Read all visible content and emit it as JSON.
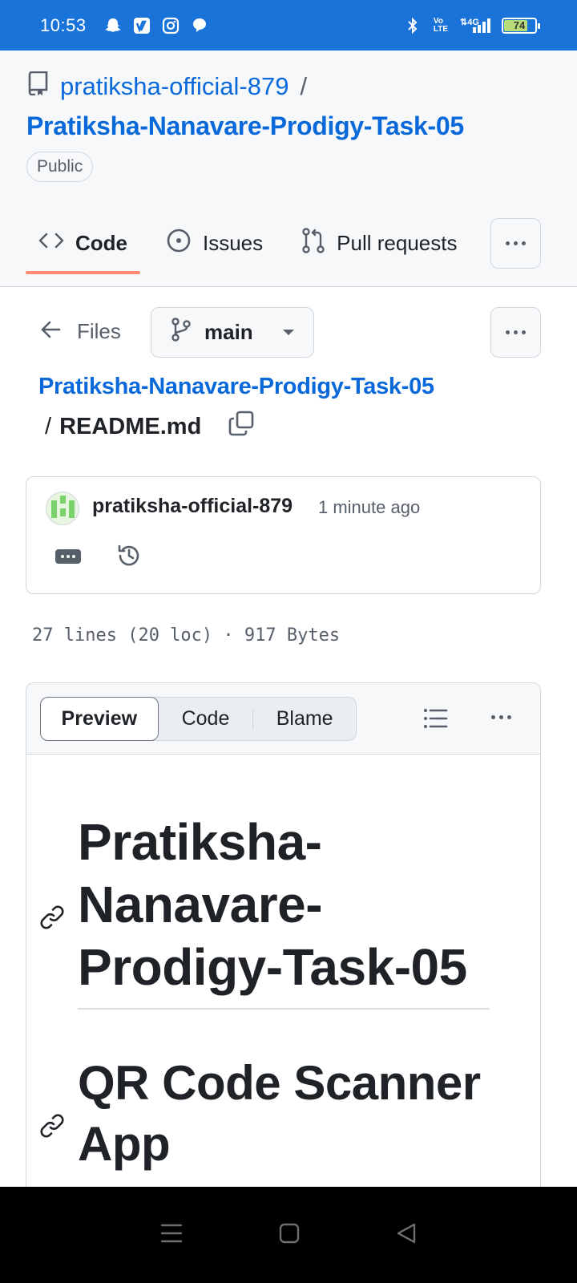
{
  "status_bar": {
    "time": "10:53",
    "battery": "74",
    "network": "4G",
    "bg_color": "#1a73d9"
  },
  "repo": {
    "owner": "pratiksha-official-879",
    "separator": "/",
    "name": "Pratiksha-Nanavare-Prodigy-Task-05",
    "visibility": "Public"
  },
  "tabs": [
    {
      "label": "Code",
      "icon": "code-icon",
      "active": true
    },
    {
      "label": "Issues",
      "icon": "issue-circle-icon"
    },
    {
      "label": "Pull requests",
      "icon": "pull-request-icon"
    }
  ],
  "files_nav": {
    "files_label": "Files",
    "branch": "main"
  },
  "breadcrumb": {
    "repo": "Pratiksha-Nanavare-Prodigy-Task-05",
    "separator": "/",
    "file": "README.md"
  },
  "commit": {
    "author": "pratiksha-official-879",
    "time": "1 minute ago"
  },
  "file_meta": "27 lines (20 loc) · 917 Bytes",
  "viewer": {
    "tabs": [
      "Preview",
      "Code",
      "Blame"
    ],
    "active_tab": "Preview"
  },
  "readme": {
    "h1": "Pratiksha-Nanavare-Prodigy-Task-05",
    "h1_lines": [
      "Pratiksha-",
      "Nanavare-",
      "Prodigy-Task-05"
    ],
    "h2": "QR Code Scanner App",
    "h2_lines": [
      "QR Code Scanner",
      "App"
    ]
  },
  "colors": {
    "link": "#0969da",
    "tab_underline": "#fd8c73",
    "border": "#d0d7de"
  }
}
